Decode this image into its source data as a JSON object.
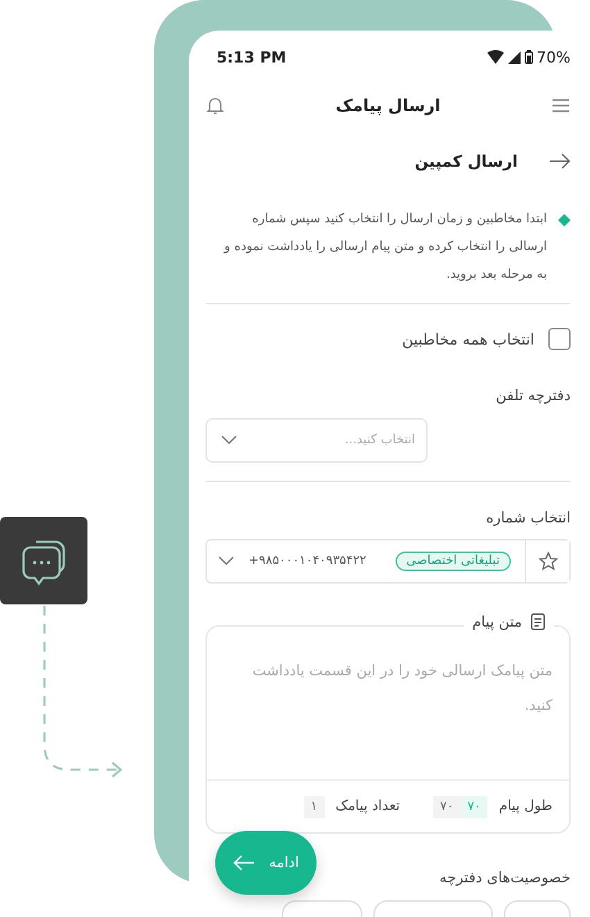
{
  "status_bar": {
    "time": "5:13 PM",
    "battery": "70%"
  },
  "header": {
    "title": "ارسال پیامک"
  },
  "page": {
    "title": "ارسال کمپین"
  },
  "info": "ابتدا مخاطبین و زمان ارسال را انتخاب کنید سپس شماره ارسالی را انتخاب کرده و متن پیام ارسالی را یادداشت نموده و به مرحله بعد بروید.",
  "select_all": {
    "label": "انتخاب همه مخاطبین",
    "checked": false
  },
  "phonebook": {
    "label": "دفترچه تلفن",
    "placeholder": "انتخاب کنید..."
  },
  "sender": {
    "label": "انتخاب شماره",
    "tag": "تبلیغاتی اختصاصی",
    "number": "+۹۸۵۰۰۰۱۰۴۰۹۳۵۴۲۲",
    "starred": false
  },
  "message": {
    "label": "متن پیام",
    "placeholder": "متن پیامک ارسالی خود را در این قسمت یادداشت کنید.",
    "length_label": "طول پیام",
    "length": "۷۰",
    "max_length": "۷۰",
    "count_label": "تعداد پیامک",
    "count": "۱"
  },
  "continue_button": "ادامه",
  "phonebook_properties": {
    "label": "خصوصیت‌های دفترچه"
  }
}
